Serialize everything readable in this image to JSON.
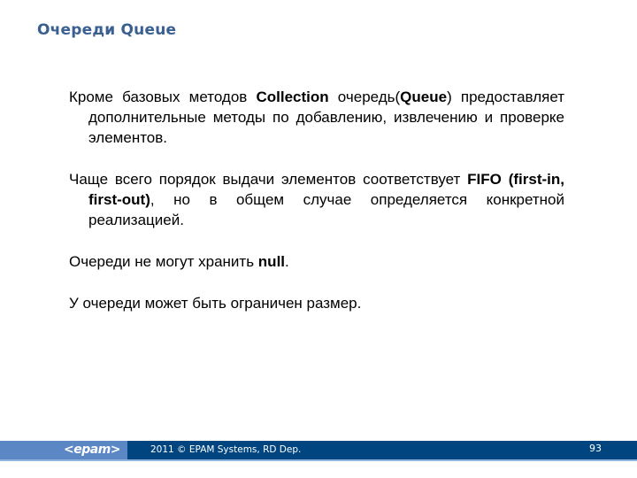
{
  "slide": {
    "title": "Очереди Queue",
    "paragraphs": [
      {
        "parts": [
          {
            "text": "Кроме базовых методов ",
            "bold": false
          },
          {
            "text": "Collection",
            "bold": true
          },
          {
            "text": " очередь(",
            "bold": false
          },
          {
            "text": "Queue",
            "bold": true
          },
          {
            "text": ") предоставляет дополнительные методы по добавлению, извлечению и проверке элементов.",
            "bold": false
          }
        ]
      },
      {
        "parts": [
          {
            "text": "Чаще всего порядок выдачи элементов соответствует ",
            "bold": false
          },
          {
            "text": "FIFO (first-in, first-out)",
            "bold": true
          },
          {
            "text": ", но в общем случае определяется конкретной реализацией.",
            "bold": false
          }
        ]
      },
      {
        "parts": [
          {
            "text": "Очереди не могут хранить ",
            "bold": false
          },
          {
            "text": "null",
            "bold": true
          },
          {
            "text": ".",
            "bold": false
          }
        ]
      },
      {
        "parts": [
          {
            "text": "У очереди может быть ограничен размер.",
            "bold": false
          }
        ]
      }
    ]
  },
  "footer": {
    "logo": "<epam>",
    "copyright": "2011 © EPAM Systems, RD Dep.",
    "page_number": "93"
  },
  "colors": {
    "title": "#3a5f91",
    "footer_dark": "#00457f",
    "footer_light": "#5b87c5"
  }
}
